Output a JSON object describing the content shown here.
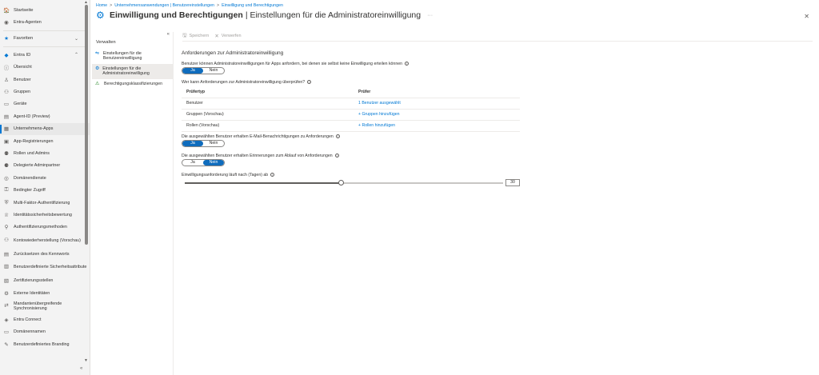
{
  "left_nav": {
    "items": [
      {
        "label": "Startseite",
        "icon": "home-icon",
        "glyph": "🏠",
        "type": "section"
      },
      {
        "label": "Entra-Agenten",
        "icon": "agent-icon",
        "glyph": "◉",
        "type": "item"
      },
      {
        "label": "Favoriten",
        "icon": "star-icon",
        "glyph": "★",
        "type": "section",
        "chevron": "⌄"
      },
      {
        "label": "Entra ID",
        "icon": "entra-icon",
        "glyph": "◆",
        "type": "section",
        "chevron": "⌃"
      },
      {
        "label": "Übersicht",
        "icon": "info-icon",
        "glyph": "ⓘ",
        "type": "item"
      },
      {
        "label": "Benutzer",
        "icon": "user-icon",
        "glyph": "♙",
        "type": "item"
      },
      {
        "label": "Gruppen",
        "icon": "group-icon",
        "glyph": "⚇",
        "type": "item"
      },
      {
        "label": "Geräte",
        "icon": "device-icon",
        "glyph": "▭",
        "type": "item"
      },
      {
        "label": "Agent-ID (Preview)",
        "icon": "agent-id-icon",
        "glyph": "▤",
        "type": "item"
      },
      {
        "label": "Unternehmens-Apps",
        "icon": "apps-icon",
        "glyph": "▦",
        "type": "item",
        "selected": true
      },
      {
        "label": "App-Registrierungen",
        "icon": "app-registration-icon",
        "glyph": "▣",
        "type": "item"
      },
      {
        "label": "Rollen und Admins",
        "icon": "roles-icon",
        "glyph": "⚉",
        "type": "item"
      },
      {
        "label": "Delegierte Adminpartner",
        "icon": "partner-icon",
        "glyph": "⚈",
        "type": "item"
      },
      {
        "label": "Domänendienste",
        "icon": "domain-services-icon",
        "glyph": "◎",
        "type": "item"
      },
      {
        "label": "Bedingter Zugriff",
        "icon": "conditional-access-icon",
        "glyph": "⚿",
        "type": "item"
      },
      {
        "label": "Multi-Faktor-Authentifizierung",
        "icon": "mfa-icon",
        "glyph": "⛨",
        "type": "item"
      },
      {
        "label": "Identitätssicherheitsbewertung",
        "icon": "score-icon",
        "glyph": "♕",
        "type": "item"
      },
      {
        "label": "Authentifizierungsmethoden",
        "icon": "auth-methods-icon",
        "glyph": "⚲",
        "type": "item"
      },
      {
        "label": "Kontowiederherstellung (Vorschau)",
        "icon": "recovery-icon",
        "glyph": "⚇",
        "type": "twoline"
      },
      {
        "label": "Zurücksetzen des Kennworts",
        "icon": "password-reset-icon",
        "glyph": "▤",
        "type": "item"
      },
      {
        "label": "Benutzerdefinierte Sicherheitsattribute",
        "icon": "attributes-icon",
        "glyph": "▥",
        "type": "twoline"
      },
      {
        "label": "Zertifizierungsstellen",
        "icon": "certificate-icon",
        "glyph": "▧",
        "type": "item"
      },
      {
        "label": "Externe Identitäten",
        "icon": "external-id-icon",
        "glyph": "⚙",
        "type": "item"
      },
      {
        "label": "Mandantenübergreifende Synchronisierung",
        "icon": "sync-icon",
        "glyph": "⇄",
        "type": "twoline"
      },
      {
        "label": "Entra Connect",
        "icon": "connect-icon",
        "glyph": "◈",
        "type": "item"
      },
      {
        "label": "Domänennamen",
        "icon": "domain-names-icon",
        "glyph": "▭",
        "type": "item"
      },
      {
        "label": "Benutzerdefiniertes Branding",
        "icon": "branding-icon",
        "glyph": "✎",
        "type": "item"
      }
    ],
    "collapse_glyph": "«"
  },
  "header": {
    "breadcrumb": [
      "Home",
      "Unternehmensanwendungen | Benutzereinstellungen",
      "Einwilligung und Berechtigungen"
    ],
    "title_main": "Einwilligung und Berechtigungen",
    "title_sub": "| Einstellungen für die Administratoreinwilligung",
    "more": "···",
    "close": "✕"
  },
  "subnav": {
    "collapse": "«",
    "heading": "Verwalten",
    "items": [
      {
        "label": "Einstellungen für die Benutzereinwilligung",
        "glyph": "⇋"
      },
      {
        "label": "Einstellungen für die Administratoreinwilligung",
        "glyph": "⚙",
        "active": true
      },
      {
        "label": "Berechtigungsklassifizierungen",
        "glyph": "⚠"
      }
    ]
  },
  "toolbar": {
    "save": "Speichern",
    "discard": "Verwerfen"
  },
  "content": {
    "section_title": "Anforderungen zur Administratoreinwilligung",
    "q1_label": "Benutzer können Administratoreinwilligungen für Apps anfordern, bei denen sie selbst keine Einwilligung erteilen können",
    "q1_options": [
      "Ja",
      "Nein"
    ],
    "q1_selected": "Ja",
    "q2_label": "Wer kann Anforderungen zur Administratoreinwilligung überprüfen?",
    "table_headers": [
      "Prüfertyp",
      "Prüfer"
    ],
    "table_rows": [
      {
        "type": "Benutzer",
        "value": "1 Benutzer ausgewählt"
      },
      {
        "type": "Gruppen (Vorschau)",
        "value": "+ Gruppen hinzufügen"
      },
      {
        "type": "Rollen (Vorschau)",
        "value": "+ Rollen hinzufügen"
      }
    ],
    "q3_label": "Die ausgewählten Benutzer erhalten E-Mail-Benachrichtigungen zu Anforderungen",
    "q3_options": [
      "Ja",
      "Nein"
    ],
    "q3_selected": "Ja",
    "q4_label": "Die ausgewählten Benutzer erhalten Erinnerungen zum Ablauf von Anforderungen",
    "q4_options": [
      "Ja",
      "Nein"
    ],
    "q4_selected": "Nein",
    "q5_label": "Einwilligungsanforderung läuft nach (Tagen) ab",
    "slider": {
      "min": 1,
      "max": 60,
      "value": 30,
      "display": "30"
    }
  },
  "colors": {
    "accent": "#0078d4",
    "toggle_on": "#0f6cbd"
  }
}
